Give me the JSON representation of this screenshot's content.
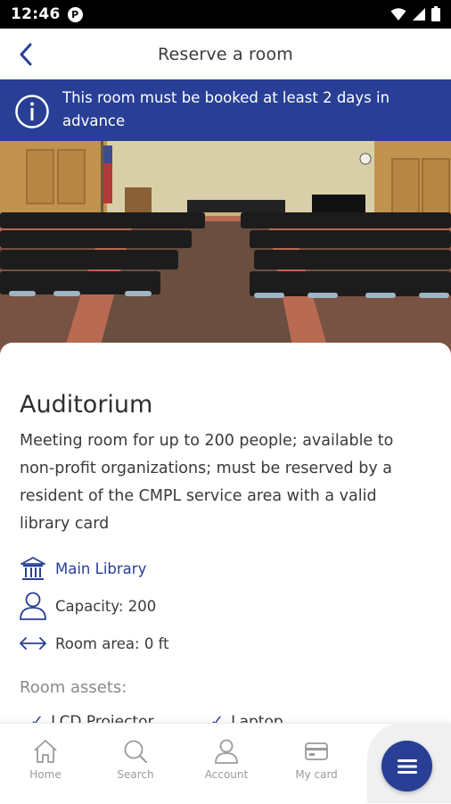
{
  "status_bar": {
    "time": "12:46",
    "app_icon_letter": "P",
    "icons": [
      "wifi-icon",
      "cell-signal-icon",
      "battery-icon"
    ]
  },
  "header": {
    "title": "Reserve a room",
    "back_icon": "chevron-left-icon"
  },
  "alert": {
    "icon": "info-icon",
    "text": "This room must be booked at least 2 days in advance"
  },
  "room": {
    "image_description_icon": "auditorium-photo",
    "title": "Auditorium",
    "description": "Meeting room for up to 200 people; available to non-profit organizations; must be reserved by a resident of the CMPL service area with a valid library card",
    "location": {
      "icon": "library-building-icon",
      "label": "Main Library"
    },
    "capacity": {
      "icon": "person-icon",
      "label": "Capacity: 200"
    },
    "area": {
      "icon": "horizontal-arrows-icon",
      "label": "Room area: 0 ft"
    },
    "assets_heading": "Room assets:",
    "assets": [
      {
        "icon": "check-icon",
        "label": "LCD Projector"
      },
      {
        "icon": "check-icon",
        "label": "Laptop"
      }
    ]
  },
  "bottom_nav": {
    "items": [
      {
        "icon": "home-icon",
        "label": "Home"
      },
      {
        "icon": "search-icon",
        "label": "Search"
      },
      {
        "icon": "account-icon",
        "label": "Account"
      },
      {
        "icon": "card-icon",
        "label": "My card"
      }
    ],
    "menu_icon": "hamburger-menu-icon"
  },
  "colors": {
    "brand_blue": "#283f95",
    "status_bar": "#000000",
    "muted_text": "#9a9a9a"
  }
}
